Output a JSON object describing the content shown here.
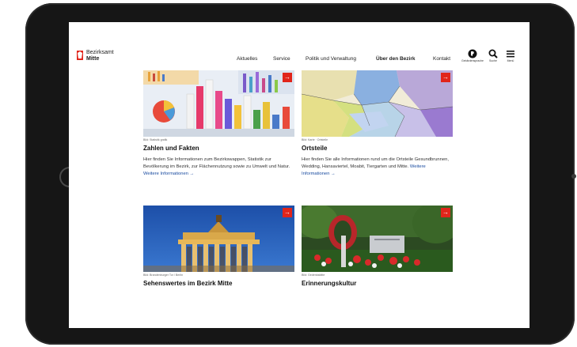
{
  "header": {
    "logo_line1": "Bezirksamt",
    "logo_line2": "Mitte",
    "nav": [
      "Aktuelles",
      "Service",
      "Politik und Verwaltung",
      "Über den Bezirk",
      "Kontakt"
    ],
    "tools": {
      "language_label": "Gebärdensprache",
      "search_label": "Suche",
      "menu_label": "Menü"
    }
  },
  "cards": [
    {
      "caption": "Bild: Statistik grafik",
      "title": "Zahlen und Fakten",
      "text": "Hier finden Sie Informationen zum Bezirkswappen, Statistik zur Bevölkerung im Bezirk, zur Flächennutzung sowie zu Umwelt und Natur.",
      "link": "Weitere Informationen →"
    },
    {
      "caption": "Bild: Karte · Ortsteile",
      "title": "Ortsteile",
      "text": "Hier finden Sie alle Informationen rund um die Ortsteile Gesundbrunnen, Wedding, Hansaviertel, Moabit, Tiergarten und Mitte.",
      "link": "Weitere Informationen →"
    },
    {
      "caption": "Bild: Brandenburger Tor / Berlin",
      "title": "Sehenswertes im Bezirk Mitte",
      "text": "",
      "link": ""
    },
    {
      "caption": "Bild: Gedenkstätte",
      "title": "Erinnerungskultur",
      "text": "",
      "link": ""
    }
  ],
  "colors": {
    "accent": "#e1251b",
    "link": "#1a4ca0",
    "device": "#161616"
  }
}
